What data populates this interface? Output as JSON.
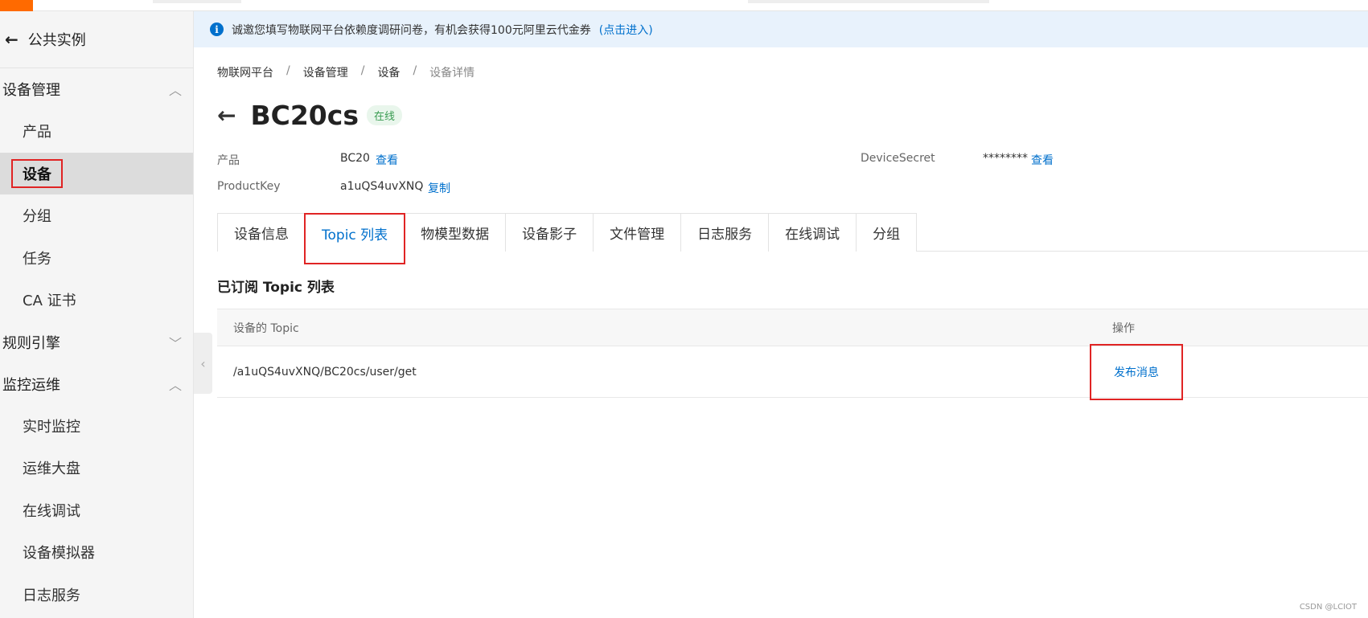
{
  "notice": {
    "text": "诚邀您填写物联网平台依赖度调研问卷，有机会获得100元阿里云代金券",
    "link": "(点击进入)"
  },
  "sidebar": {
    "back_label": "公共实例",
    "groups": [
      {
        "label": "设备管理",
        "expanded": true,
        "items": [
          {
            "label": "产品"
          },
          {
            "label": "设备",
            "active": true
          },
          {
            "label": "分组"
          },
          {
            "label": "任务"
          },
          {
            "label": "CA 证书"
          }
        ]
      },
      {
        "label": "规则引擎",
        "expanded": false,
        "items": []
      },
      {
        "label": "监控运维",
        "expanded": true,
        "items": [
          {
            "label": "实时监控"
          },
          {
            "label": "运维大盘"
          },
          {
            "label": "在线调试"
          },
          {
            "label": "设备模拟器"
          },
          {
            "label": "日志服务"
          }
        ]
      }
    ]
  },
  "breadcrumb": [
    "物联网平台",
    "设备管理",
    "设备",
    "设备详情"
  ],
  "breadcrumb_sep": "/",
  "device": {
    "name": "BC20cs",
    "status": "在线"
  },
  "meta": {
    "product_label": "产品",
    "product_value": "BC20",
    "product_link": "查看",
    "productkey_label": "ProductKey",
    "productkey_value": "a1uQS4uvXNQ",
    "productkey_link": "复制",
    "secret_label": "DeviceSecret",
    "secret_value": "********",
    "secret_link": "查看"
  },
  "tabs": [
    {
      "label": "设备信息"
    },
    {
      "label": "Topic 列表",
      "active": true
    },
    {
      "label": "物模型数据"
    },
    {
      "label": "设备影子"
    },
    {
      "label": "文件管理"
    },
    {
      "label": "日志服务"
    },
    {
      "label": "在线调试"
    },
    {
      "label": "分组"
    }
  ],
  "section_title": "已订阅 Topic 列表",
  "table": {
    "headers": {
      "topic": "设备的 Topic",
      "op": "操作"
    },
    "rows": [
      {
        "topic": "/a1uQS4uvXNQ/BC20cs/user/get",
        "op": "发布消息"
      }
    ]
  },
  "watermark": "CSDN @LCIOT",
  "colors": {
    "accent": "#0070cc",
    "brand": "#ff6a00",
    "highlight_box": "#e02424",
    "online": "#3a9c52"
  }
}
